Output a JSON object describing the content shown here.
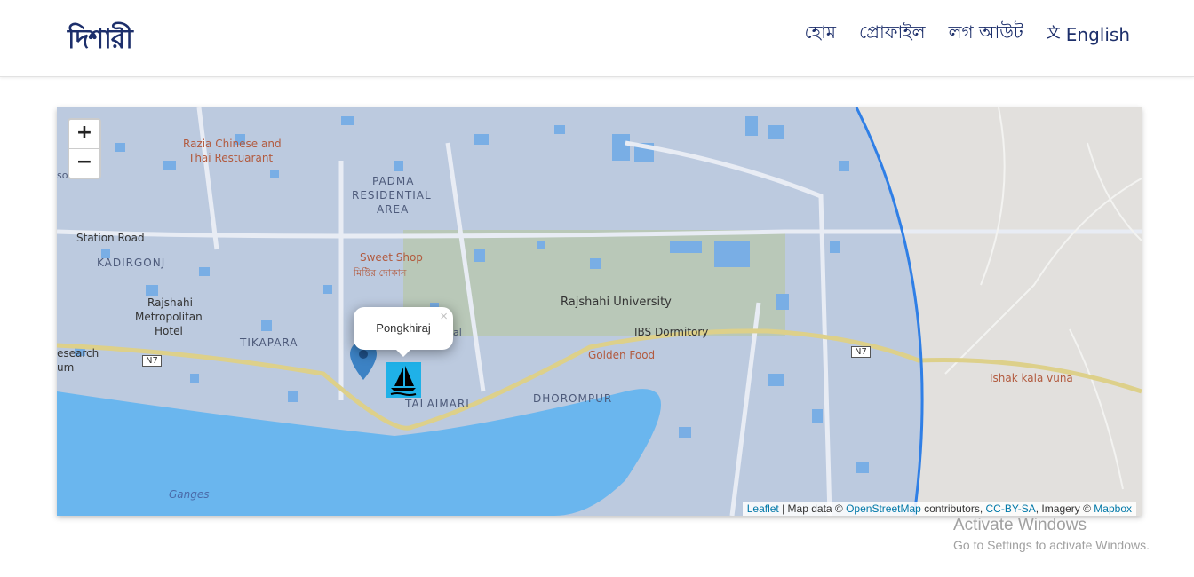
{
  "header": {
    "logo": "দিশারী",
    "nav": {
      "home": "হোম",
      "profile": "প্রোফাইল",
      "logout": "লগ আউট",
      "language_icon": "translate-icon",
      "language": "English"
    }
  },
  "map": {
    "zoom_in": "+",
    "zoom_out": "−",
    "popup": {
      "title": "Pongkhiraj",
      "close": "×"
    },
    "labels": {
      "razia": "Razia Chinese and",
      "razia2": "Thai Restuarant",
      "padma1": "PADMA",
      "padma2": "RESIDENTIAL",
      "padma3": "AREA",
      "station_road": "Station Road",
      "kadirgonj": "KADIRGONJ",
      "sweet_shop": "Sweet Shop",
      "sweet_shop_bn": "মিষ্টির দোকান",
      "rajshahi_metro1": "Rajshahi",
      "rajshahi_metro2": "Metropolitan",
      "rajshahi_metro3": "Hotel",
      "rajshahi_university": "Rajshahi University",
      "tikapara": "TIKAPARA",
      "ibs_dormitory": "IBS Dormitory",
      "golden_food": "Golden Food",
      "research": "esearch",
      "um": "um",
      "n7_left": "N7",
      "n7_right": "N7",
      "dhorompur": "DHOROMPUR",
      "talaimari": "TALAIMARI",
      "ishak": "Ishak kala vuna",
      "ganges": "Ganges",
      "sonit": "sonit",
      "al": "al"
    },
    "attribution": {
      "leaflet": "Leaflet",
      "text1": " | Map data © ",
      "osm": "OpenStreetMap",
      "text2": " contributors, ",
      "cc": "CC-BY-SA",
      "text3": ", Imagery © ",
      "mapbox": "Mapbox"
    },
    "markers": [
      {
        "type": "location-pin-icon",
        "color": "#3c82c4"
      },
      {
        "type": "sailboat-icon",
        "color": "#1fb1e8"
      }
    ]
  },
  "watermark": {
    "line1": "Activate Windows",
    "line2": "Go to Settings to activate Windows."
  },
  "colors": {
    "brand": "#1d2f6b",
    "accent": "#e8762d",
    "water": "#6ab6ee",
    "radius_circle": "#2f7fe6"
  }
}
